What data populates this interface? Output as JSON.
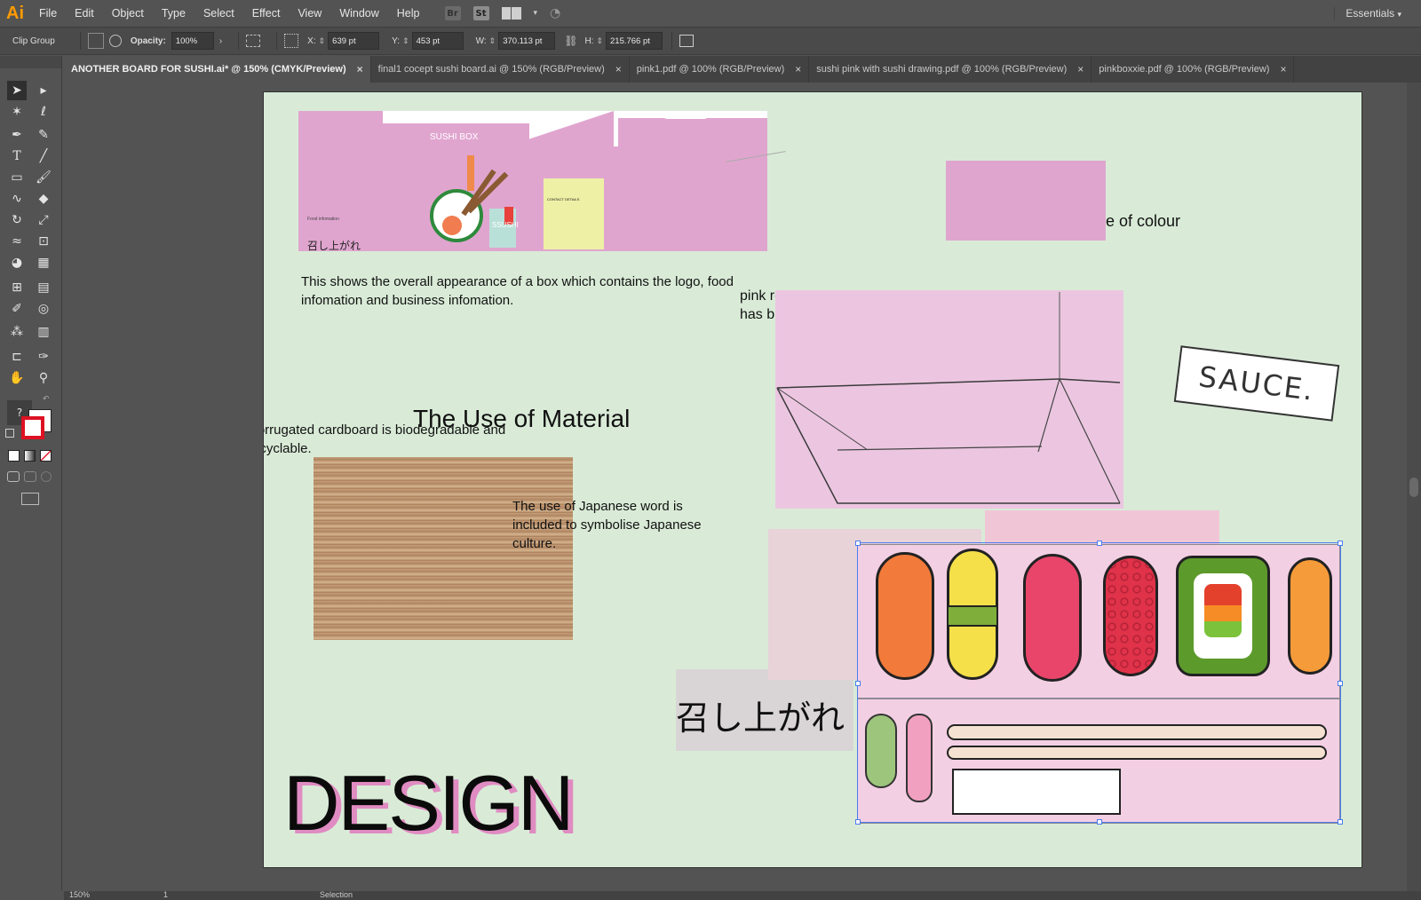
{
  "app": {
    "logo": "Ai",
    "workspace": "Essentials"
  },
  "menu": [
    "File",
    "Edit",
    "Object",
    "Type",
    "Select",
    "Effect",
    "View",
    "Window",
    "Help"
  ],
  "bar_icons": {
    "bridge": "Br",
    "stock": "St"
  },
  "control": {
    "selection_type": "Clip Group",
    "opacity_label": "Opacity:",
    "opacity_value": "100%",
    "x_label": "X:",
    "x_value": "639 pt",
    "y_label": "Y:",
    "y_value": "453 pt",
    "w_label": "W:",
    "w_value": "370.113 pt",
    "h_label": "H:",
    "h_value": "215.766 pt"
  },
  "tabs": [
    {
      "label": "ANOTHER BOARD FOR SUSHI.ai* @ 150% (CMYK/Preview)",
      "active": true
    },
    {
      "label": "final1 cocept sushi board.ai @ 150% (RGB/Preview)",
      "active": false
    },
    {
      "label": "pink1.pdf @ 100% (RGB/Preview)",
      "active": false
    },
    {
      "label": "sushi pink with sushi drawing.pdf @ 100% (RGB/Preview)",
      "active": false
    },
    {
      "label": "pinkboxxie.pdf @ 100% (RGB/Preview)",
      "active": false
    }
  ],
  "status": {
    "zoom": "150%",
    "page": "1",
    "tool": "Selection"
  },
  "board": {
    "box_title": "SUSHI BOX",
    "box_food_info": "Food infomation",
    "box_japanese": "召し上がれ",
    "box_label": "SSUSHI",
    "box_contact": "CONTACT DETAILS",
    "caption_box": "This shows the overall appearance of a box which contains the logo, food infomation and business infomation.",
    "caption_colour_tail": "e of colour",
    "caption_pink_line1": "pink represents cute",
    "caption_pink_line2": "has b",
    "heading_material": "The Use of Material",
    "caption_cardboard": "Corrugated cardboard is biodegradable and recyclable.",
    "caption_japanese": "The use of Japanese word is included to symbolise Japanese culture.",
    "japanese_word": "召し上がれ",
    "sauce_label": "SAUCE.",
    "design_title": "DESIGN"
  },
  "colors": {
    "artboard_bg": "#d9ebd7",
    "box_pink": "#e0a5cf",
    "selection_blue": "#4a7cf0",
    "ai_orange": "#ff9a00"
  }
}
